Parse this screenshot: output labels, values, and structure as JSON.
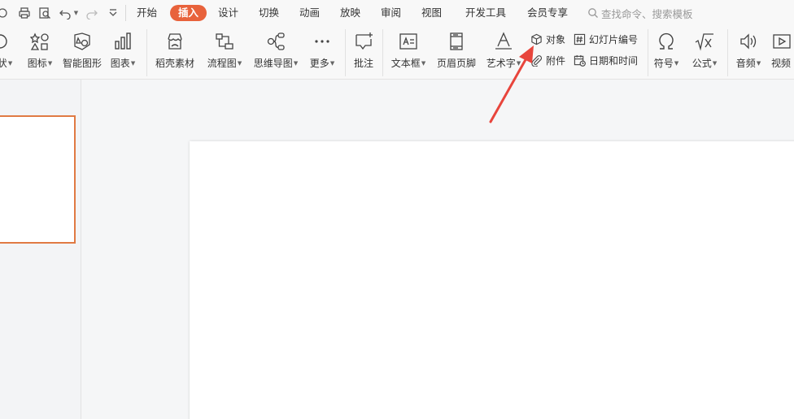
{
  "menubar": {
    "tabs": [
      "开始",
      "插入",
      "设计",
      "切换",
      "动画",
      "放映",
      "审阅",
      "视图",
      "开发工具",
      "会员专享"
    ],
    "active_tab": "插入",
    "search_placeholder": "查找命令、搜索模板"
  },
  "ribbon": {
    "buttons": [
      {
        "label": "状",
        "icon": "shape-icon",
        "dropdown": true
      },
      {
        "label": "图标",
        "icon": "icons-icon",
        "dropdown": true
      },
      {
        "label": "智能图形",
        "icon": "smart-graphic-icon",
        "dropdown": false
      },
      {
        "label": "图表",
        "icon": "chart-icon",
        "dropdown": true
      },
      {
        "label": "稻壳素材",
        "icon": "docer-material-icon",
        "dropdown": false
      },
      {
        "label": "流程图",
        "icon": "flowchart-icon",
        "dropdown": true
      },
      {
        "label": "思维导图",
        "icon": "mindmap-icon",
        "dropdown": true
      },
      {
        "label": "更多",
        "icon": "more-icon",
        "dropdown": true
      },
      {
        "label": "批注",
        "icon": "comment-icon",
        "dropdown": false
      },
      {
        "label": "文本框",
        "icon": "textbox-icon",
        "dropdown": true
      },
      {
        "label": "页眉页脚",
        "icon": "header-footer-icon",
        "dropdown": false
      },
      {
        "label": "艺术字",
        "icon": "wordart-icon",
        "dropdown": true
      },
      {
        "label": "符号",
        "icon": "omega-icon",
        "dropdown": true
      },
      {
        "label": "公式",
        "icon": "formula-icon",
        "dropdown": true
      },
      {
        "label": "音频",
        "icon": "audio-icon",
        "dropdown": true
      },
      {
        "label": "视频",
        "icon": "video-icon",
        "dropdown": false
      }
    ],
    "small_buttons": [
      {
        "label": "对象",
        "icon": "object-icon"
      },
      {
        "label": "附件",
        "icon": "attachment-icon"
      },
      {
        "label": "幻灯片编号",
        "icon": "slide-number-icon"
      },
      {
        "label": "日期和时间",
        "icon": "datetime-icon"
      }
    ]
  },
  "colors": {
    "accent": "#e8623b",
    "thumb_border": "#e07a43",
    "arrow": "#e8453c"
  }
}
